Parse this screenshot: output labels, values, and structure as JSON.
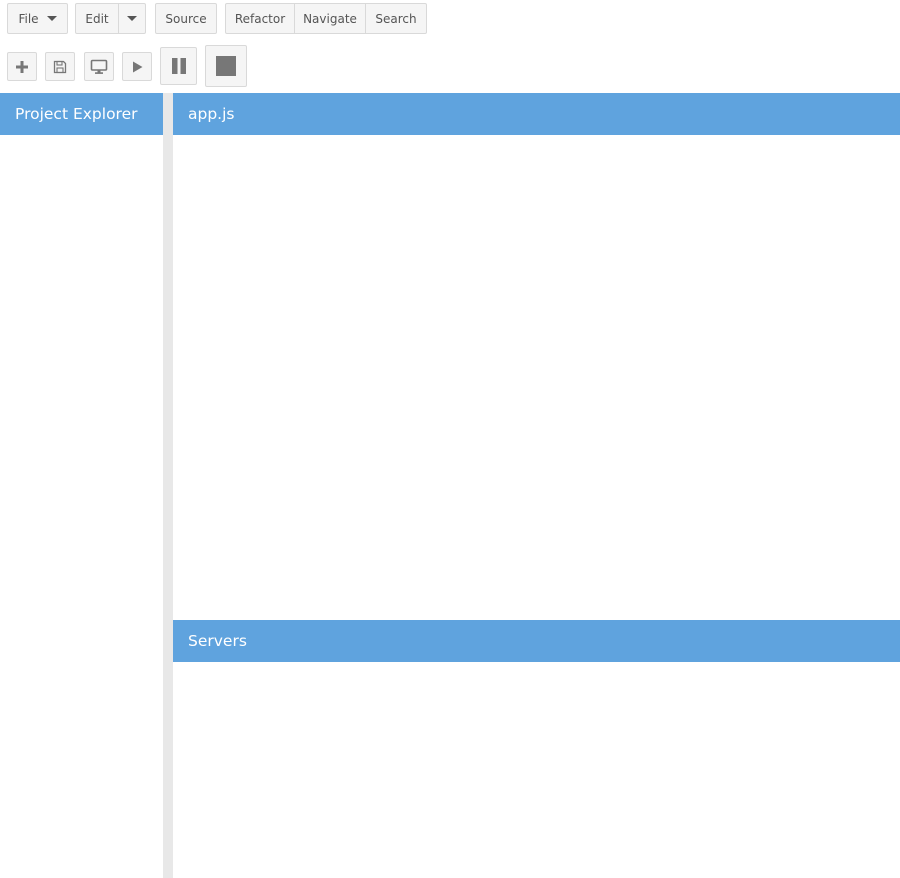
{
  "menubar": {
    "file": "File",
    "edit": "Edit",
    "source": "Source",
    "refactor": "Refactor",
    "navigate": "Navigate",
    "search": "Search"
  },
  "toolbar": {
    "icons": [
      "plus-icon",
      "save-icon",
      "monitor-icon",
      "play-icon",
      "pause-icon",
      "stop-icon"
    ]
  },
  "panes": {
    "project_explorer": "Project Explorer",
    "editor_tab": "app.js",
    "servers": "Servers"
  },
  "colors": {
    "header_blue": "#5fa3de",
    "splitter": "#e8e8e8",
    "button_bg": "#f5f5f5",
    "icon_gray": "#777777"
  }
}
